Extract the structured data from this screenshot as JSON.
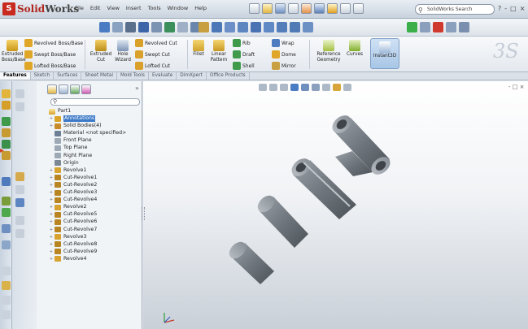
{
  "app": {
    "logo_mark": "S",
    "logo_solid": "Solid",
    "logo_works": "Works",
    "menus": [
      "File",
      "Edit",
      "View",
      "Insert",
      "Tools",
      "Window",
      "Help"
    ],
    "search_placeholder": "SolidWorks Search",
    "window_buttons": [
      "?",
      "-",
      "□",
      "×"
    ]
  },
  "ribbon": {
    "extruded_boss": "Extruded Boss/Base",
    "revolved_boss": "Revolved Boss/Base",
    "swept_boss": "Swept Boss/Base",
    "lofted_boss": "Lofted Boss/Base",
    "extruded_cut": "Extruded Cut",
    "hole_wizard": "Hole Wizard",
    "revolved_cut": "Revolved Cut",
    "swept_cut": "Swept Cut",
    "lofted_cut": "Lofted Cut",
    "fillet": "Fillet",
    "linear_pattern": "Linear Pattern",
    "rib": "Rib",
    "draft": "Draft",
    "shell": "Shell",
    "wrap": "Wrap",
    "dome": "Dome",
    "mirror": "Mirror",
    "reference_geometry": "Reference Geometry",
    "curves": "Curves",
    "instant3d": "Instant3D"
  },
  "tabs": [
    "Features",
    "Sketch",
    "Surfaces",
    "Sheet Metal",
    "Mold Tools",
    "Evaluate",
    "DimXpert",
    "Office Products"
  ],
  "tree": {
    "part": "Part1",
    "items": [
      {
        "label": "Annotations",
        "icon": "annotations-icon",
        "expand": "+",
        "selected": true
      },
      {
        "label": "Solid Bodies(4)",
        "icon": "solid-bodies-icon",
        "expand": "+"
      },
      {
        "label": "Material <not specified>",
        "icon": "material-icon",
        "expand": ""
      },
      {
        "label": "Front Plane",
        "icon": "plane-icon",
        "expand": ""
      },
      {
        "label": "Top Plane",
        "icon": "plane-icon",
        "expand": ""
      },
      {
        "label": "Right Plane",
        "icon": "plane-icon",
        "expand": ""
      },
      {
        "label": "Origin",
        "icon": "origin-icon",
        "expand": ""
      },
      {
        "label": "Revolve1",
        "icon": "revolve-icon",
        "expand": "+"
      },
      {
        "label": "Cut-Revolve1",
        "icon": "cut-revolve-icon",
        "expand": "+"
      },
      {
        "label": "Cut-Revolve2",
        "icon": "cut-revolve-icon",
        "expand": "+"
      },
      {
        "label": "Cut-Revolve3",
        "icon": "cut-revolve-icon",
        "expand": "+"
      },
      {
        "label": "Cut-Revolve4",
        "icon": "cut-revolve-icon",
        "expand": "+"
      },
      {
        "label": "Revolve2",
        "icon": "revolve-icon",
        "expand": "+"
      },
      {
        "label": "Cut-Revolve5",
        "icon": "cut-revolve-icon",
        "expand": "+"
      },
      {
        "label": "Cut-Revolve6",
        "icon": "cut-revolve-icon",
        "expand": "+"
      },
      {
        "label": "Cut-Revolve7",
        "icon": "cut-revolve-icon",
        "expand": "+"
      },
      {
        "label": "Revolve3",
        "icon": "revolve-icon",
        "expand": "+"
      },
      {
        "label": "Cut-Revolve8",
        "icon": "cut-revolve-icon",
        "expand": "+"
      },
      {
        "label": "Cut-Revolve9",
        "icon": "cut-revolve-icon",
        "expand": "+"
      },
      {
        "label": "Revolve4",
        "icon": "revolve-icon",
        "expand": "+"
      }
    ]
  },
  "panel": {
    "chevron": "»"
  },
  "colors": {
    "accent_red": "#c82a20",
    "selection": "#3d7ac7",
    "model_gray": "#6f767d"
  }
}
